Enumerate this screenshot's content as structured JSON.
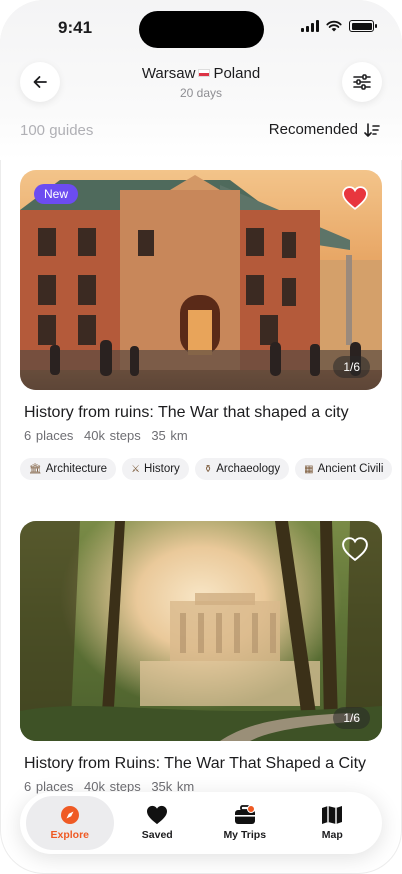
{
  "status": {
    "time": "9:41"
  },
  "header": {
    "city": "Warsaw",
    "country": "Poland",
    "subtitle": "20 days"
  },
  "list": {
    "count_label": "100 guides",
    "sort_label": "Recomended"
  },
  "cards": [
    {
      "badge": "New",
      "image_counter": "1/6",
      "favorited": true,
      "title": "History from ruins: The War that shaped a city",
      "meta": [
        "6 places",
        "40k steps",
        "35 km"
      ],
      "tags": [
        {
          "icon": "columns-icon",
          "label": "Architecture"
        },
        {
          "icon": "swords-icon",
          "label": "History"
        },
        {
          "icon": "vase-icon",
          "label": "Archaeology"
        },
        {
          "icon": "scroll-icon",
          "label": "Ancient Civili"
        }
      ]
    },
    {
      "image_counter": "1/6",
      "favorited": false,
      "title": "History from Ruins: The War That Shaped a City",
      "meta": [
        "6 places",
        "40k steps",
        "35k km"
      ]
    }
  ],
  "nav": {
    "items": [
      {
        "label": "Explore",
        "icon": "compass-icon",
        "active": true
      },
      {
        "label": "Saved",
        "icon": "heart-icon"
      },
      {
        "label": "My Trips",
        "icon": "suitcase-icon",
        "has_dot": true
      },
      {
        "label": "Map",
        "icon": "map-icon"
      }
    ]
  },
  "colors": {
    "accent": "#ef5a24",
    "badge": "#6c4cf1",
    "heart": "#e8363e"
  }
}
